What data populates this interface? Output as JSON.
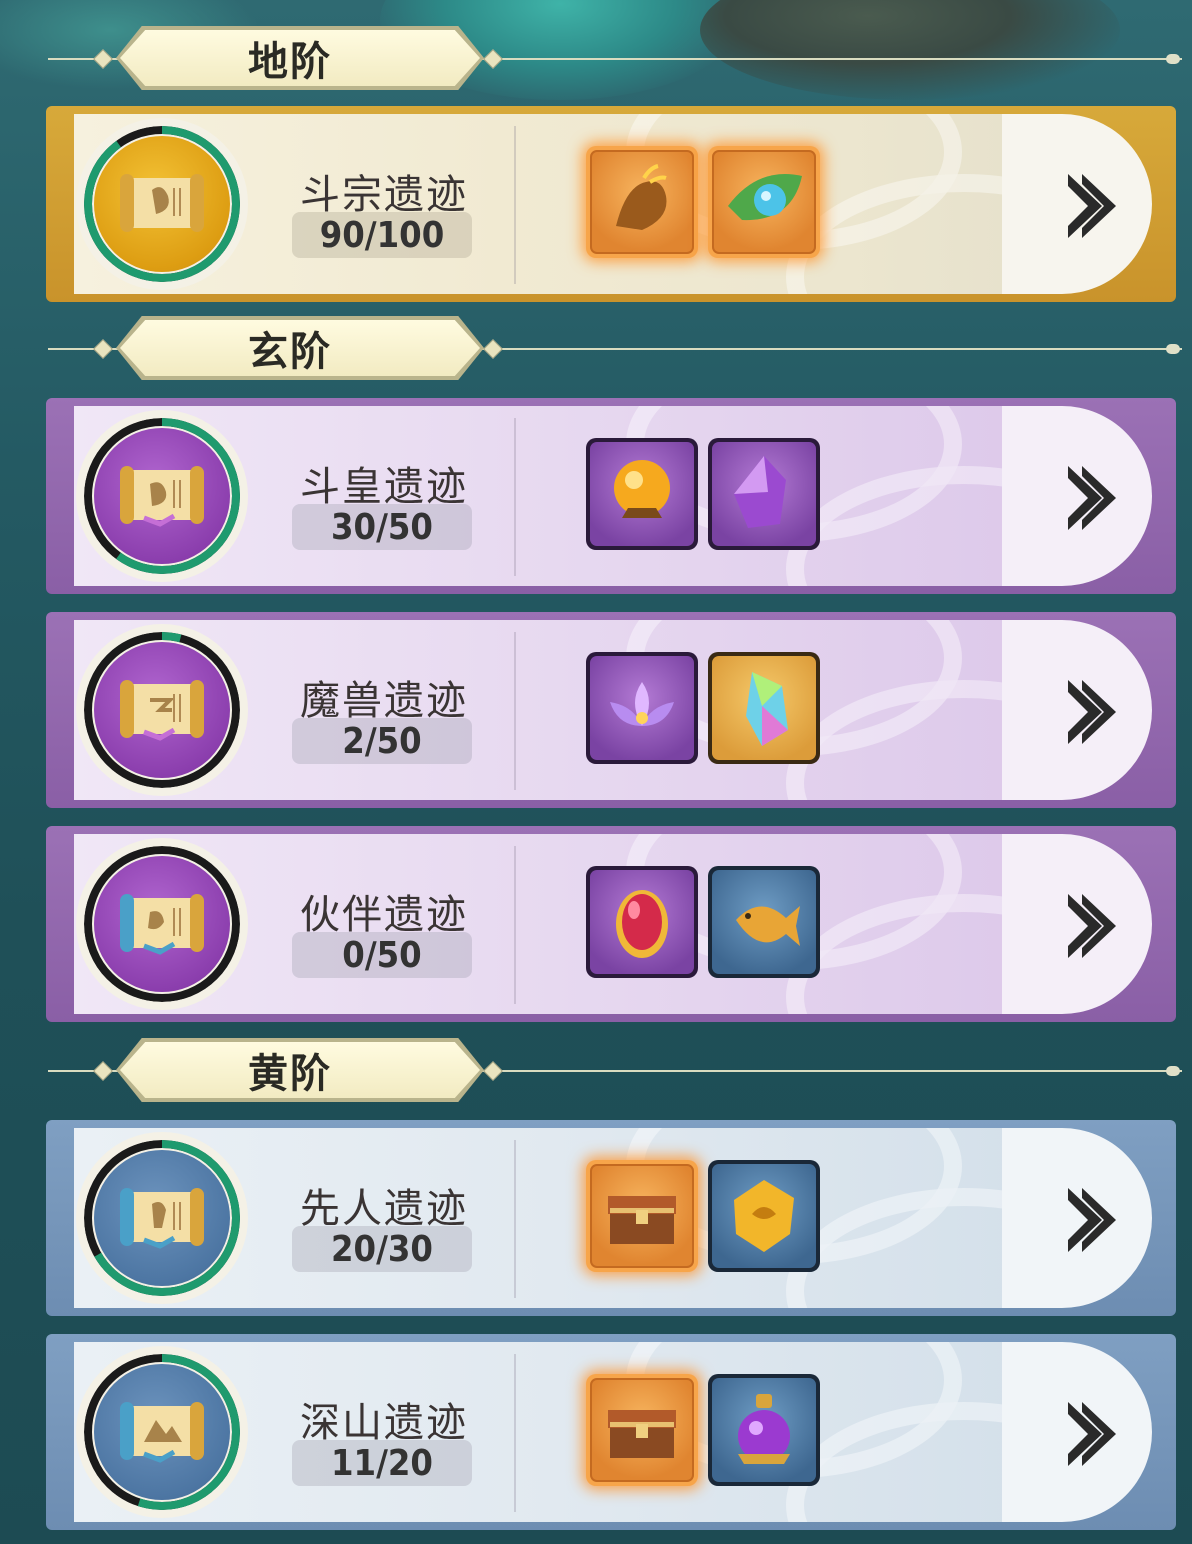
{
  "sections": [
    {
      "title": "地阶"
    },
    {
      "title": "玄阶"
    },
    {
      "title": "黄阶"
    }
  ],
  "relics": [
    {
      "name": "斗宗遗迹",
      "progress_text": "90/100",
      "progress": 0.9,
      "tier": "gold",
      "rewards": [
        {
          "icon": "golden-root-icon",
          "frame": "orange"
        },
        {
          "icon": "leaf-pearl-icon",
          "frame": "orange"
        }
      ]
    },
    {
      "name": "斗皇遗迹",
      "progress_text": "30/50",
      "progress": 0.6,
      "tier": "purple",
      "rewards": [
        {
          "icon": "golden-orb-icon",
          "frame": "purple"
        },
        {
          "icon": "purple-crystal-icon",
          "frame": "purple"
        }
      ]
    },
    {
      "name": "魔兽遗迹",
      "progress_text": "2/50",
      "progress": 0.04,
      "tier": "purple",
      "rewards": [
        {
          "icon": "lotus-icon",
          "frame": "purple"
        },
        {
          "icon": "rainbow-crystal-icon",
          "frame": "gold"
        }
      ]
    },
    {
      "name": "伙伴遗迹",
      "progress_text": "0/50",
      "progress": 0.0,
      "tier": "purple",
      "rewards": [
        {
          "icon": "red-egg-icon",
          "frame": "purple"
        },
        {
          "icon": "golden-fish-icon",
          "frame": "blue"
        }
      ]
    },
    {
      "name": "先人遗迹",
      "progress_text": "20/30",
      "progress": 0.667,
      "tier": "blue",
      "rewards": [
        {
          "icon": "treasure-chest-icon",
          "frame": "orange"
        },
        {
          "icon": "gold-ore-icon",
          "frame": "blue"
        }
      ]
    },
    {
      "name": "深山遗迹",
      "progress_text": "11/20",
      "progress": 0.55,
      "tier": "blue",
      "rewards": [
        {
          "icon": "treasure-chest-icon",
          "frame": "orange"
        },
        {
          "icon": "purple-potion-icon",
          "frame": "blue"
        }
      ]
    }
  ],
  "colors": {
    "progress_ring": "#1f9a6e",
    "ring_track": "#1a1a1a"
  }
}
